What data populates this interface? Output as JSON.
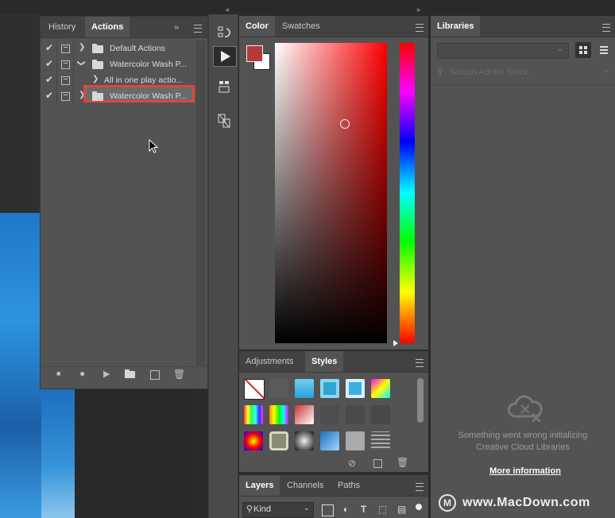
{
  "actions_panel": {
    "tabs": [
      "History",
      "Actions"
    ],
    "rows": [
      {
        "label": "Default Actions",
        "expanded": false,
        "kind": "set"
      },
      {
        "label": "Watercolor Wash P...",
        "expanded": true,
        "kind": "set"
      },
      {
        "label": "All in one play actio...",
        "expanded": false,
        "kind": "action"
      },
      {
        "label": "Watercolor Wash P...",
        "expanded": false,
        "kind": "set",
        "highlighted": true
      }
    ],
    "bottom_icons": [
      "stop-icon",
      "record-icon",
      "play-icon",
      "new-set-icon",
      "new-action-icon",
      "delete-icon"
    ]
  },
  "color_panel": {
    "tabs": [
      "Color",
      "Swatches"
    ],
    "foreground": "#b73a3a",
    "background": "#ffffff",
    "hue": "#ff0000"
  },
  "adjustments_panel": {
    "tabs": [
      "Adjustments",
      "Styles"
    ]
  },
  "layers_panel": {
    "tabs": [
      "Layers",
      "Channels",
      "Paths"
    ],
    "kind_filter": "Kind"
  },
  "libraries_panel": {
    "tab": "Libraries",
    "search_placeholder": "Search Adobe Stock",
    "error_line1": "Something went wrong initializing",
    "error_line2": "Creative Cloud Libraries",
    "more_info": "More information"
  },
  "watermark": "www.MacDown.com",
  "colors": {
    "highlight_box": "#e0463a",
    "panel_bg": "#535353",
    "tab_bg": "#424242"
  }
}
